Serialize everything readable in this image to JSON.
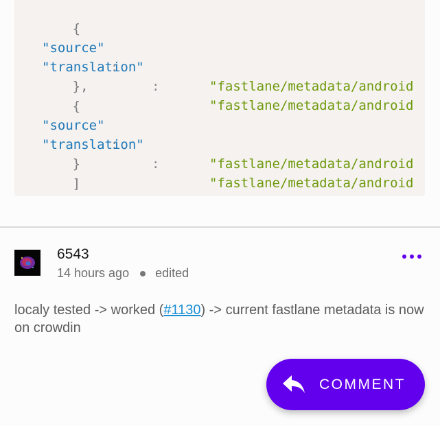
{
  "code": {
    "lines": [
      {
        "open": "{"
      },
      {
        "key": "\"source\"",
        "colon": ":",
        "value": "\"fastlane/metadata/android"
      },
      {
        "key": "\"translation\"",
        "colon": ":",
        "value": "\"fastlane/metadata/android"
      },
      {
        "close": "},"
      },
      {
        "open": "{"
      },
      {
        "key": "\"source\"",
        "colon": ":",
        "value": "\"fastlane/metadata/android"
      },
      {
        "key": "\"translation\"",
        "colon": ":",
        "value": "\"fastlane/metadata/android"
      },
      {
        "close": "}"
      },
      {
        "close": "]"
      }
    ]
  },
  "comment": {
    "author": "6543",
    "time": "14 hours ago",
    "edited_label": "edited",
    "body_before": "localy tested -> worked (",
    "issue_link": "#1130",
    "body_after": ") -> current fastlane metadata is now on crowdin"
  },
  "fab": {
    "label": "COMMENT"
  },
  "colors": {
    "accent": "#6200ee",
    "link": "#1a8fd6",
    "code_bg": "#f5f2f0",
    "code_key": "#1f79b8",
    "code_string": "#6f9a0d"
  }
}
